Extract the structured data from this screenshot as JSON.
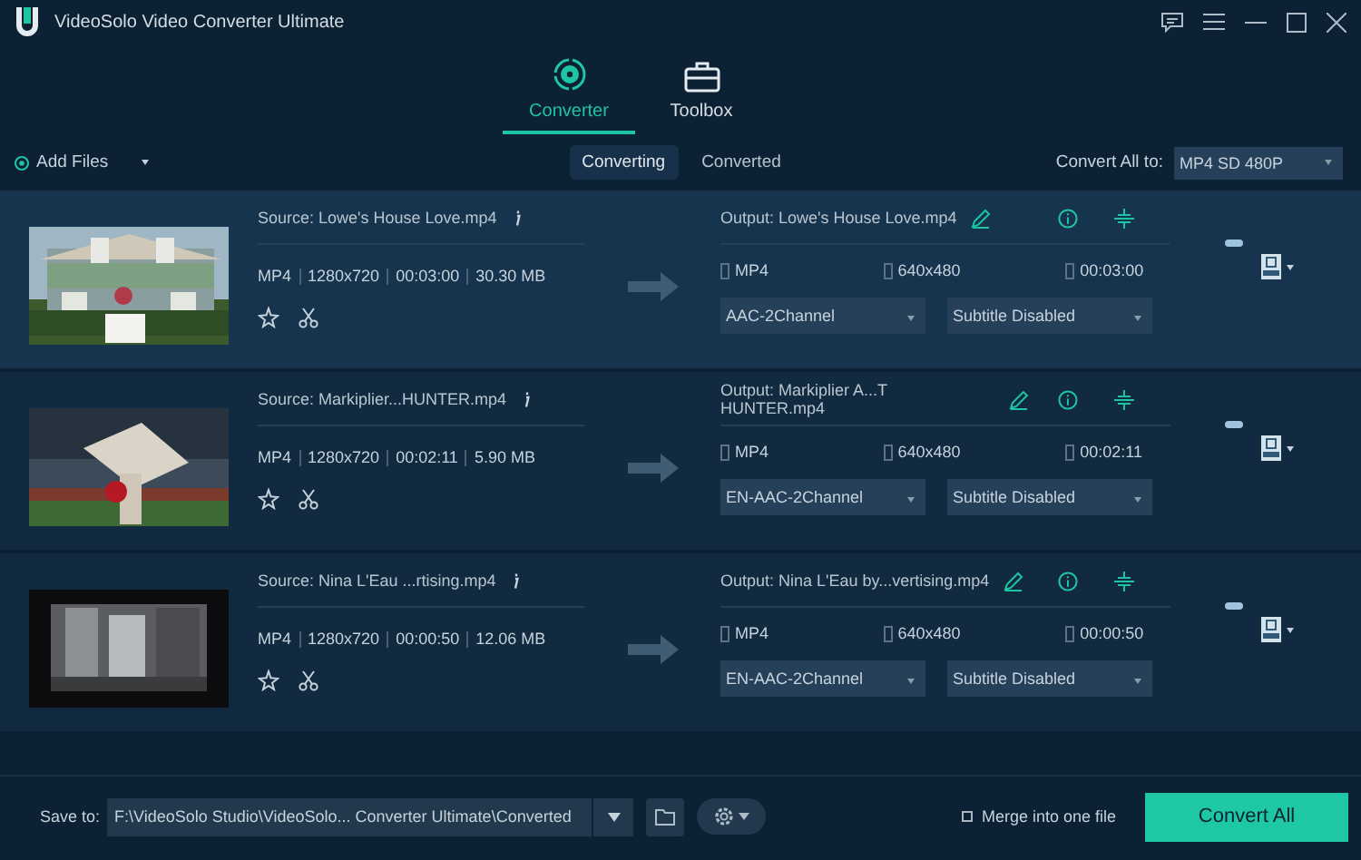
{
  "window": {
    "title": "VideoSolo Video Converter Ultimate"
  },
  "main_tabs": [
    {
      "label": "Converter",
      "selected": true
    },
    {
      "label": "Toolbox",
      "selected": false
    }
  ],
  "toolbar": {
    "add_files": "Add Files",
    "view_tabs": [
      {
        "label": "Converting",
        "selected": true
      },
      {
        "label": "Converted",
        "selected": false
      }
    ],
    "convert_all_label": "Convert All to:",
    "convert_all_format": "MP4 SD 480P"
  },
  "files": [
    {
      "kind": "picture",
      "source": "Source: Lowe's House Love.mp4",
      "format": "MP4",
      "resolution": "1280x720",
      "duration": "00:03:00",
      "size": "30.30 MB",
      "output": "Output: Lowe's House Love.mp4",
      "out_format": "MP4",
      "out_resolution": "640x480",
      "out_duration": "00:03:00",
      "audio": "AAC-2Channel",
      "subtitle": "Subtitle Disabled",
      "selected": true
    },
    {
      "kind": "picture",
      "source": "Source: Markiplier...HUNTER.mp4",
      "format": "MP4",
      "resolution": "1280x720",
      "duration": "00:02:11",
      "size": "5.90 MB",
      "output": "Output: Markiplier A...T HUNTER.mp4",
      "out_format": "MP4",
      "out_resolution": "640x480",
      "out_duration": "00:02:11",
      "audio": "EN-AAC-2Channel",
      "subtitle": "Subtitle Disabled",
      "selected": false
    },
    {
      "kind": "picture",
      "source": "Source: Nina L'Eau ...rtising.mp4",
      "format": "MP4",
      "resolution": "1280x720",
      "duration": "00:00:50",
      "size": "12.06 MB",
      "output": "Output: Nina L'Eau by...vertising.mp4",
      "out_format": "MP4",
      "out_resolution": "640x480",
      "out_duration": "00:00:50",
      "audio": "EN-AAC-2Channel",
      "subtitle": "Subtitle Disabled",
      "selected": false
    }
  ],
  "bottom": {
    "save_label": "Save to:",
    "save_path": "F:\\VideoSolo Studio\\VideoSolo... Converter Ultimate\\Converted",
    "merge_label": "Merge into one file",
    "merge_checked": false,
    "convert_button": "Convert All"
  }
}
